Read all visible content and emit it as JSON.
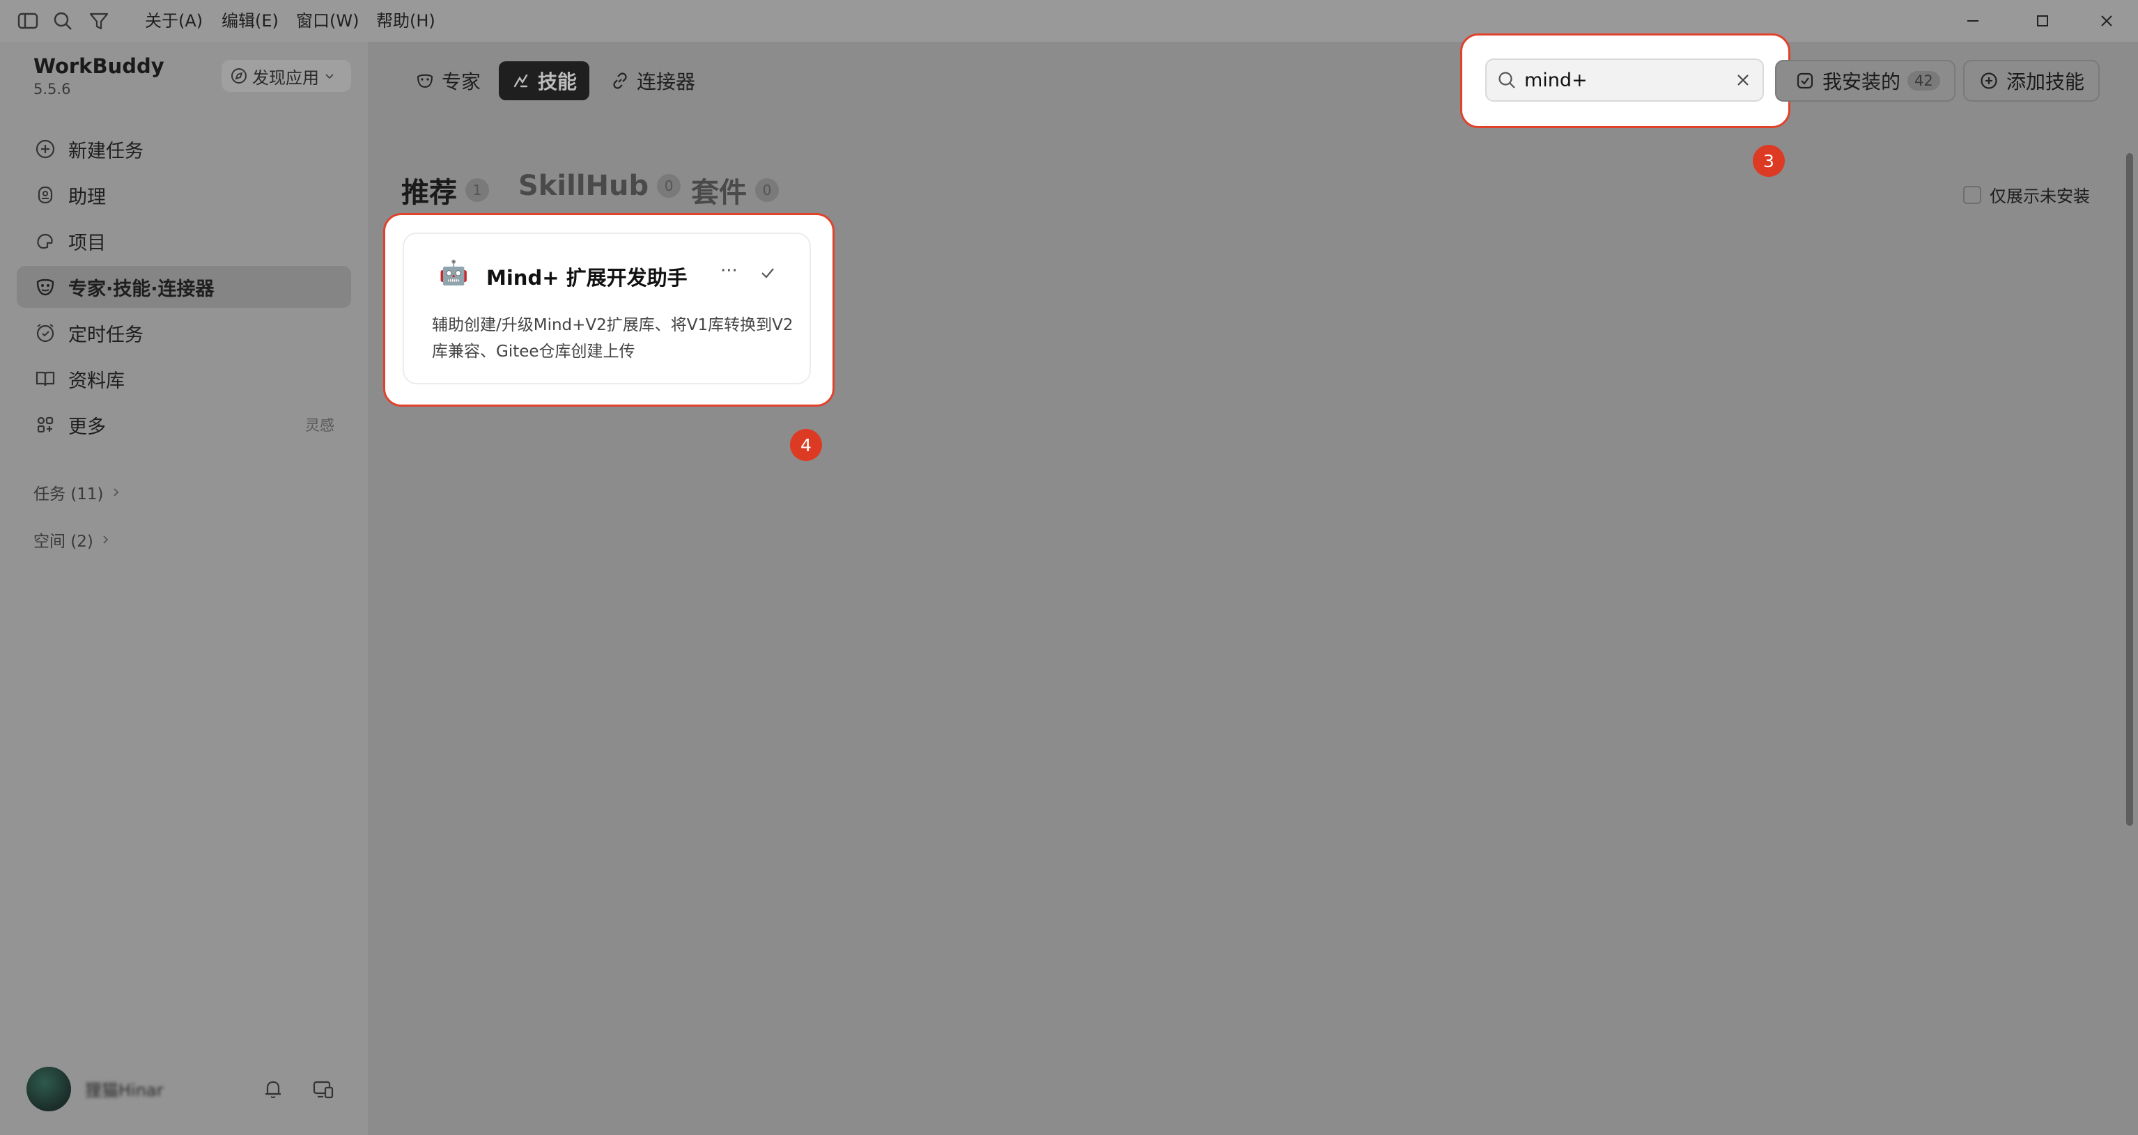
{
  "menu": [
    "关于(A)",
    "编辑(E)",
    "窗口(W)",
    "帮助(H)"
  ],
  "brand": {
    "name": "WorkBuddy",
    "version": "5.5.6",
    "discover_label": "发现应用"
  },
  "nav": [
    {
      "label": "新建任务",
      "icon": "plus-circle-icon"
    },
    {
      "label": "助理",
      "icon": "assistant-icon"
    },
    {
      "label": "项目",
      "icon": "project-icon"
    },
    {
      "label": "专家·技能·连接器",
      "icon": "expert-icon",
      "active": true
    },
    {
      "label": "定时任务",
      "icon": "alarm-icon"
    },
    {
      "label": "资料库",
      "icon": "book-icon"
    },
    {
      "label": "更多",
      "icon": "grid-icon",
      "extra": "灵感"
    }
  ],
  "sections": [
    {
      "label": "任务 (11)"
    },
    {
      "label": "空间 (2)"
    }
  ],
  "user": {
    "name": "狸猫Hinar"
  },
  "tabs": [
    {
      "label": "专家",
      "icon": "mask-icon"
    },
    {
      "label": "技能",
      "icon": "skill-icon",
      "active": true
    },
    {
      "label": "连接器",
      "icon": "link-icon"
    }
  ],
  "search": {
    "value": "mind+",
    "placeholder": ""
  },
  "installed": {
    "label": "我安装的",
    "count": "42"
  },
  "add_skill": {
    "label": "添加技能"
  },
  "categories": [
    {
      "label": "推荐",
      "count": "1",
      "color": "#1a1a1a"
    },
    {
      "label": "SkillHub",
      "count": "0",
      "color": "#4a4a4a"
    },
    {
      "label": "套件",
      "count": "0",
      "color": "#4a4a4a"
    }
  ],
  "filter": {
    "label": "仅展示未安装"
  },
  "card": {
    "emoji": "🤖",
    "title": "Mind+ 扩展开发助手",
    "more": "···",
    "description": "辅助创建/升级Mind+V2扩展库、将V1库转换到V2库兼容、Gitee仓库创建上传"
  },
  "annotations": {
    "search_badge": "3",
    "card_badge": "4"
  },
  "colors": {
    "highlight": "#e0422c",
    "badge": "#dd3a24"
  }
}
